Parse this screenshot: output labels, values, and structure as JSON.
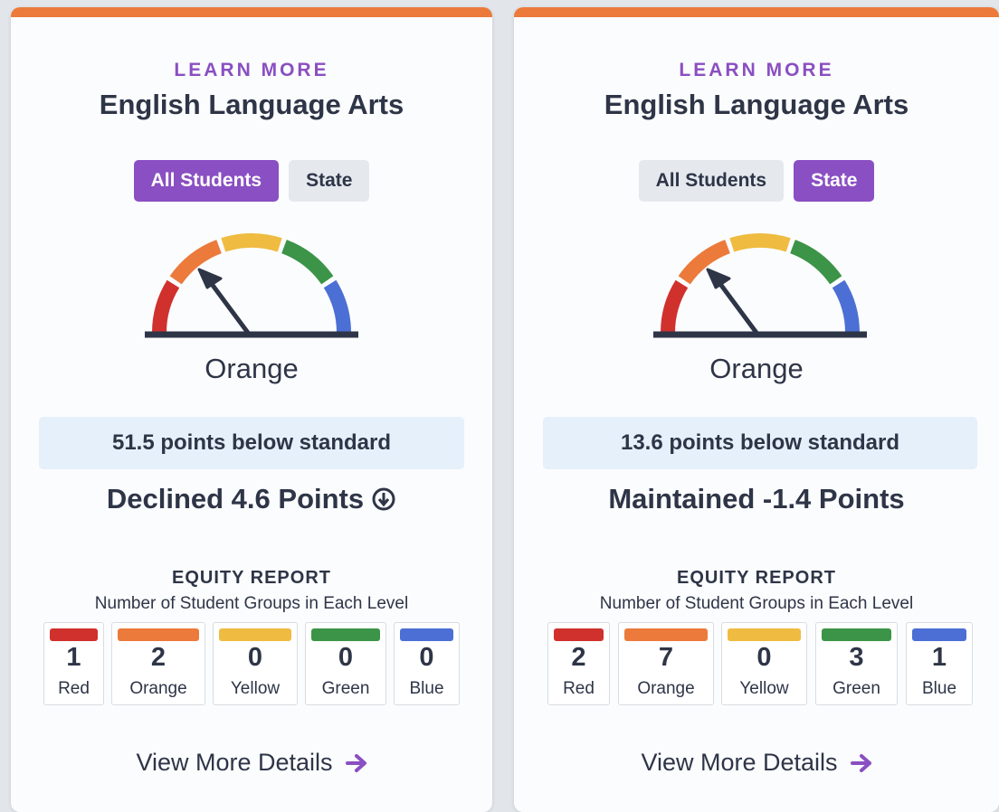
{
  "theme": {
    "accent": "#8a4fc2",
    "top_bar": "#ec7a3b",
    "text": "#2e3547",
    "level_colors": {
      "red": "#d0312d",
      "orange": "#ec7a3b",
      "yellow": "#efbb40",
      "green": "#3b9447",
      "blue": "#4b6fd4"
    }
  },
  "cards": [
    {
      "learn_more": "LEARN MORE",
      "title": "English Language Arts",
      "tabs": [
        {
          "label": "All Students",
          "active": true
        },
        {
          "label": "State",
          "active": false
        }
      ],
      "gauge": {
        "level": "orange",
        "icon": "gauge-icon"
      },
      "status_label": "Orange",
      "metric": "51.5 points below standard",
      "change": {
        "text": "Declined 4.6 Points",
        "icon": "arrow-down-circle-icon"
      },
      "equity_title": "EQUITY REPORT",
      "equity_subtitle": "Number of Student Groups in Each Level",
      "equity": [
        {
          "count": "1",
          "label": "Red",
          "color": "#d0312d"
        },
        {
          "count": "2",
          "label": "Orange",
          "color": "#ec7a3b"
        },
        {
          "count": "0",
          "label": "Yellow",
          "color": "#efbb40"
        },
        {
          "count": "0",
          "label": "Green",
          "color": "#3b9447"
        },
        {
          "count": "0",
          "label": "Blue",
          "color": "#4b6fd4"
        }
      ],
      "view_details": "View More Details"
    },
    {
      "learn_more": "LEARN MORE",
      "title": "English Language Arts",
      "tabs": [
        {
          "label": "All Students",
          "active": false
        },
        {
          "label": "State",
          "active": true
        }
      ],
      "gauge": {
        "level": "orange",
        "icon": "gauge-icon"
      },
      "status_label": "Orange",
      "metric": "13.6 points below standard",
      "change": {
        "text": "Maintained -1.4 Points",
        "icon": ""
      },
      "equity_title": "EQUITY REPORT",
      "equity_subtitle": "Number of Student Groups in Each Level",
      "equity": [
        {
          "count": "2",
          "label": "Red",
          "color": "#d0312d"
        },
        {
          "count": "7",
          "label": "Orange",
          "color": "#ec7a3b"
        },
        {
          "count": "0",
          "label": "Yellow",
          "color": "#efbb40"
        },
        {
          "count": "3",
          "label": "Green",
          "color": "#3b9447"
        },
        {
          "count": "1",
          "label": "Blue",
          "color": "#4b6fd4"
        }
      ],
      "view_details": "View More Details"
    }
  ]
}
